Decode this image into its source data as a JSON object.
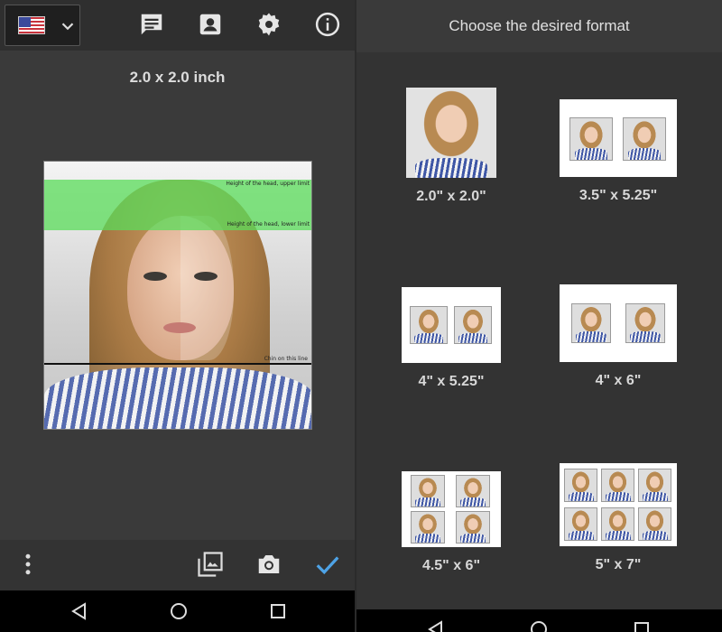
{
  "left": {
    "size_label": "2.0 x 2.0 inch",
    "guides": {
      "upper": "Height of the head, upper limit",
      "lower": "Height of the head, lower limit",
      "chin": "Chin on this line"
    },
    "toolbar_icons": [
      "flag-us-icon",
      "chevron-down-icon",
      "message-icon",
      "contact-icon",
      "gear-icon",
      "info-icon"
    ],
    "bottom_icons": [
      "more-vert-icon",
      "gallery-icon",
      "camera-icon",
      "check-icon"
    ],
    "accent_color": "#4ea3e6"
  },
  "right": {
    "title": "Choose the desired format",
    "formats": [
      {
        "label": "2.0\" x 2.0\""
      },
      {
        "label": "3.5\" x 5.25\""
      },
      {
        "label": "4\" x 5.25\""
      },
      {
        "label": "4\" x 6\""
      },
      {
        "label": "4.5\" x 6\""
      },
      {
        "label": "5\" x 7\""
      }
    ]
  },
  "nav": [
    "back-icon",
    "home-icon",
    "recents-icon"
  ]
}
